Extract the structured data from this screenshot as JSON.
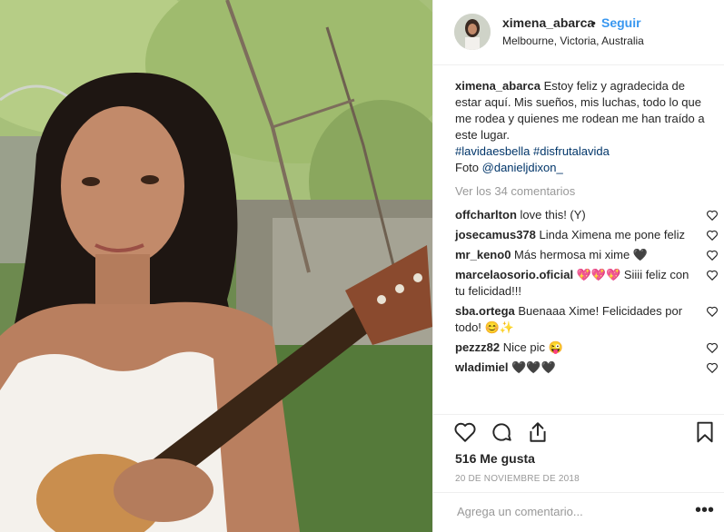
{
  "post": {
    "username": "ximena_abarca",
    "follow_label": "Seguir",
    "separator": "•",
    "location": "Melbourne, Victoria, Australia",
    "caption_text": "Estoy feliz y agradecida de estar aquí. Mis sueños, mis luchas, todo lo que me rodea y quienes me rodean me han traído a este lugar.",
    "hashtag1": "#lavidaesbella",
    "hashtag2": "#disfrutalavida",
    "photo_prefix": "Foto",
    "photo_credit": "@danieljdixon_",
    "view_all": "Ver los 34 comentarios",
    "likes": "516 Me gusta",
    "date": "20 DE NOVIEMBRE DE 2018",
    "comment_placeholder": "Agrega un comentario...",
    "more_label": "•••"
  },
  "comments": [
    {
      "user": "offcharlton",
      "text": "love this! (Y)"
    },
    {
      "user": "josecamus378",
      "text": "Linda Ximena me pone feliz"
    },
    {
      "user": "mr_keno0",
      "text": "Más hermosa mi xime 🖤"
    },
    {
      "user": "marcelaosorio.oficial",
      "text": "💖💖💖 Siiii feliz con tu felicidad!!!"
    },
    {
      "user": "sba.ortega",
      "text": "Buenaaa Xime! Felicidades por todo! 😊✨"
    },
    {
      "user": "pezzz82",
      "text": "Nice pic 😜"
    },
    {
      "user": "wladimiel",
      "text": "🖤🖤🖤"
    }
  ],
  "icons": {
    "like": "heart-icon",
    "comment": "comment-icon",
    "share": "share-icon",
    "save": "bookmark-icon",
    "comment_like": "small-heart-icon"
  },
  "colors": {
    "link": "#3897f0",
    "hashtag": "#003569",
    "muted": "#999999",
    "text": "#262626"
  }
}
